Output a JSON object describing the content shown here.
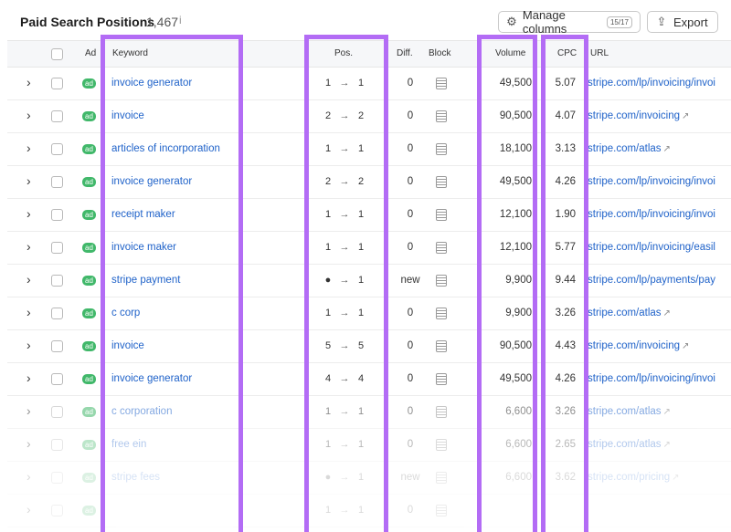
{
  "header": {
    "title": "Paid Search Positions",
    "count": "1,467",
    "info_icon": "i",
    "manage_label": "Manage columns",
    "manage_badge": "15/17",
    "export_label": "Export"
  },
  "columns": {
    "ad": "Ad",
    "keyword": "Keyword",
    "pos": "Pos.",
    "diff": "Diff.",
    "block": "Block",
    "volume": "Volume",
    "cpc": "CPC",
    "url": "URL"
  },
  "rows": [
    {
      "ad": "ad",
      "keyword": "invoice generator",
      "pos_from": "1",
      "pos_to": "1",
      "diff": "0",
      "volume": "49,500",
      "cpc": "5.07",
      "url": "stripe.com/lp/invoicing/invoi"
    },
    {
      "ad": "ad",
      "keyword": "invoice",
      "pos_from": "2",
      "pos_to": "2",
      "diff": "0",
      "volume": "90,500",
      "cpc": "4.07",
      "url": "stripe.com/invoicing"
    },
    {
      "ad": "ad",
      "keyword": "articles of incorporation",
      "pos_from": "1",
      "pos_to": "1",
      "diff": "0",
      "volume": "18,100",
      "cpc": "3.13",
      "url": "stripe.com/atlas"
    },
    {
      "ad": "ad",
      "keyword": "invoice generator",
      "pos_from": "2",
      "pos_to": "2",
      "diff": "0",
      "volume": "49,500",
      "cpc": "4.26",
      "url": "stripe.com/lp/invoicing/invoi"
    },
    {
      "ad": "ad",
      "keyword": "receipt maker",
      "pos_from": "1",
      "pos_to": "1",
      "diff": "0",
      "volume": "12,100",
      "cpc": "1.90",
      "url": "stripe.com/lp/invoicing/invoi"
    },
    {
      "ad": "ad",
      "keyword": "invoice maker",
      "pos_from": "1",
      "pos_to": "1",
      "diff": "0",
      "volume": "12,100",
      "cpc": "5.77",
      "url": "stripe.com/lp/invoicing/easil"
    },
    {
      "ad": "ad",
      "keyword": "stripe payment",
      "pos_from": "●",
      "pos_to": "1",
      "diff": "new",
      "volume": "9,900",
      "cpc": "9.44",
      "url": "stripe.com/lp/payments/pay"
    },
    {
      "ad": "ad",
      "keyword": "c corp",
      "pos_from": "1",
      "pos_to": "1",
      "diff": "0",
      "volume": "9,900",
      "cpc": "3.26",
      "url": "stripe.com/atlas"
    },
    {
      "ad": "ad",
      "keyword": "invoice",
      "pos_from": "5",
      "pos_to": "5",
      "diff": "0",
      "volume": "90,500",
      "cpc": "4.43",
      "url": "stripe.com/invoicing"
    },
    {
      "ad": "ad",
      "keyword": "invoice generator",
      "pos_from": "4",
      "pos_to": "4",
      "diff": "0",
      "volume": "49,500",
      "cpc": "4.26",
      "url": "stripe.com/lp/invoicing/invoi"
    },
    {
      "ad": "ad",
      "keyword": "c corporation",
      "pos_from": "1",
      "pos_to": "1",
      "diff": "0",
      "volume": "6,600",
      "cpc": "3.26",
      "url": "stripe.com/atlas"
    },
    {
      "ad": "ad",
      "keyword": "free ein",
      "pos_from": "1",
      "pos_to": "1",
      "diff": "0",
      "volume": "6,600",
      "cpc": "2.65",
      "url": "stripe.com/atlas"
    },
    {
      "ad": "ad",
      "keyword": "stripe fees",
      "pos_from": "●",
      "pos_to": "1",
      "diff": "new",
      "volume": "6,600",
      "cpc": "3.62",
      "url": "stripe.com/pricing"
    },
    {
      "ad": "ad",
      "keyword": "",
      "pos_from": "1",
      "pos_to": "1",
      "diff": "0",
      "volume": "",
      "cpc": "",
      "url": ""
    }
  ],
  "colors": {
    "highlight": "#b36cf5",
    "link": "#1f62c9",
    "ad_badge": "#41b86a"
  },
  "icons": {
    "manage": "gear-icon",
    "export": "export-icon",
    "expand": "chevron-right-icon",
    "external": "external-link-icon",
    "block": "block-icon"
  }
}
